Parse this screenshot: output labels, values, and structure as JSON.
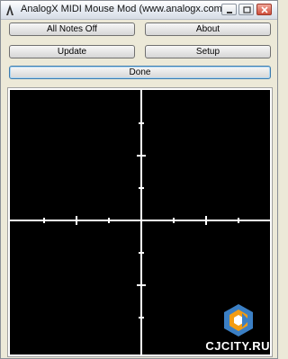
{
  "window": {
    "title": "AnalogX MIDI Mouse Mod (www.analogx.com)"
  },
  "buttons": {
    "all_notes_off": "All Notes Off",
    "about": "About",
    "update": "Update",
    "setup": "Setup",
    "done": "Done"
  },
  "watermark": {
    "text": "CJCITY.RU"
  },
  "colors": {
    "pad_background": "#000000",
    "crosshair": "#ffffff",
    "logo_orange": "#f39c12",
    "logo_blue": "#3b7fc4"
  }
}
